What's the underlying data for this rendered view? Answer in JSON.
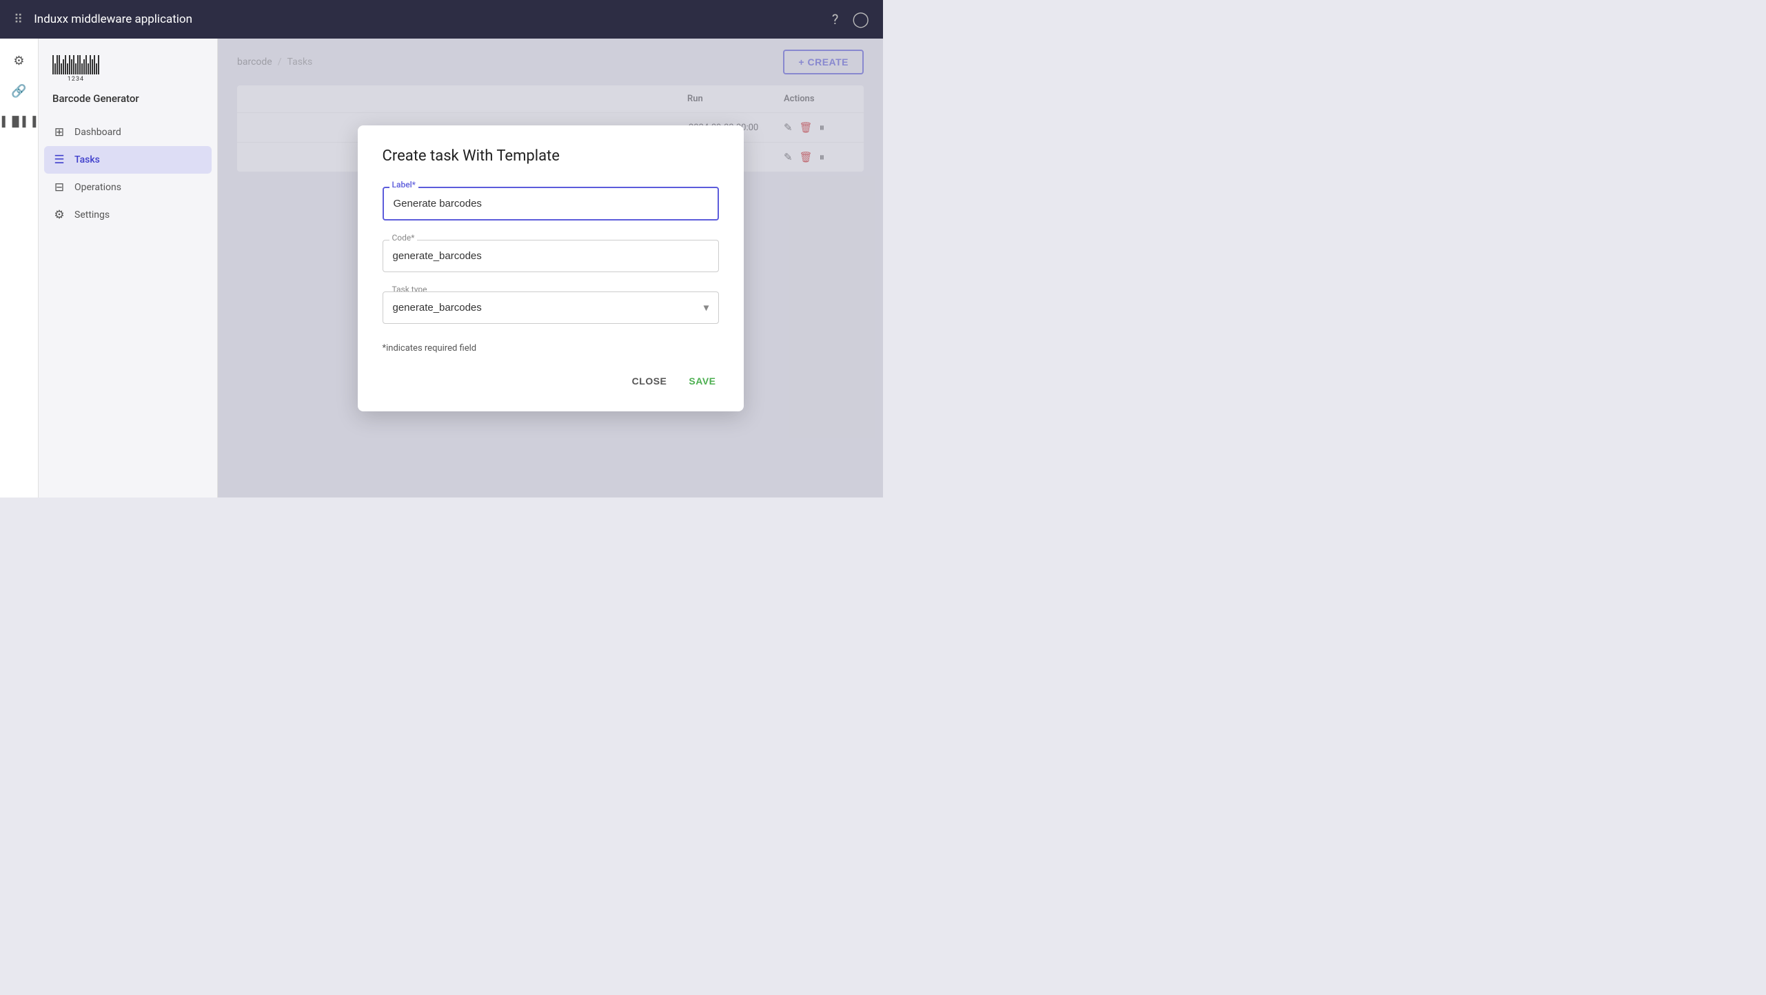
{
  "app": {
    "title": "Induxx middleware application"
  },
  "topbar": {
    "title": "Induxx middleware application",
    "help_icon": "?",
    "user_icon": "👤"
  },
  "sidebar": {
    "app_name": "Barcode Generator",
    "barcode_number": "1234",
    "nav_items": [
      {
        "id": "dashboard",
        "label": "Dashboard",
        "icon": "⊞"
      },
      {
        "id": "tasks",
        "label": "Tasks",
        "icon": "☰"
      },
      {
        "id": "operations",
        "label": "Operations",
        "icon": "⊟"
      },
      {
        "id": "settings",
        "label": "Settings",
        "icon": "⚙"
      }
    ]
  },
  "breadcrumb": {
    "parent": "barcode",
    "separator": "/",
    "current": "Tasks"
  },
  "header": {
    "create_button": "+ CREATE"
  },
  "table": {
    "columns": [
      "Run",
      "Actions"
    ],
    "rows": [
      {
        "run": "2024-09-03 00:00",
        "actions": [
          "edit",
          "delete",
          "pause"
        ]
      },
      {
        "run": "",
        "actions": [
          "edit",
          "delete",
          "pause"
        ]
      }
    ]
  },
  "dialog": {
    "title": "Create task With Template",
    "label_field": {
      "label": "Label*",
      "value": "Generate barcodes",
      "placeholder": "Label"
    },
    "code_field": {
      "label": "Code*",
      "value": "generate_barcodes",
      "placeholder": "Code"
    },
    "task_type_field": {
      "label": "Task type",
      "value": "generate_barcodes",
      "options": [
        "generate_barcodes"
      ]
    },
    "required_note": "*indicates required field",
    "close_button": "CLOSE",
    "save_button": "SAVE"
  }
}
